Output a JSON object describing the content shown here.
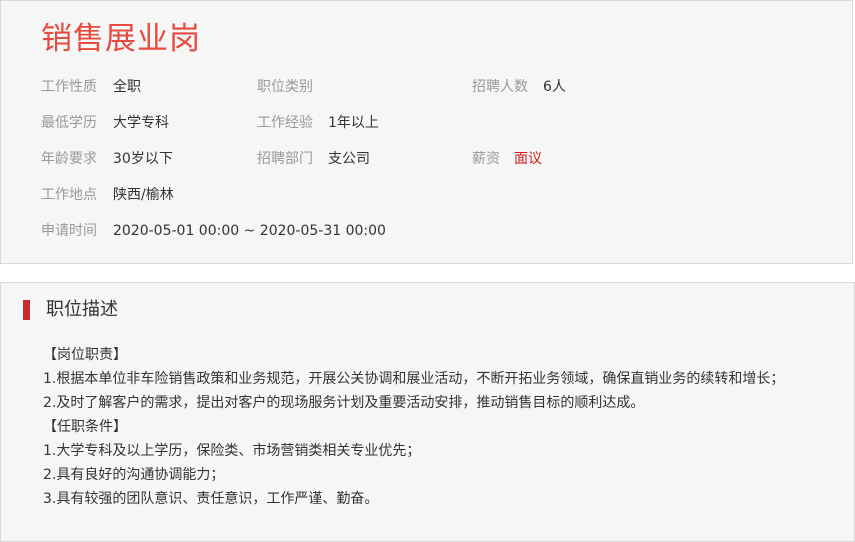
{
  "job": {
    "title": "销售展业岗"
  },
  "fields": {
    "nature_label": "工作性质",
    "nature_value": "全职",
    "category_label": "职位类别",
    "category_value": "",
    "count_label": "招聘人数",
    "count_value": "6人",
    "education_label": "最低学历",
    "education_value": "大学专科",
    "experience_label": "工作经验",
    "experience_value": "1年以上",
    "age_label": "年龄要求",
    "age_value": "30岁以下",
    "department_label": "招聘部门",
    "department_value": "支公司",
    "salary_label": "薪资",
    "salary_value": "面议",
    "location_label": "工作地点",
    "location_value": "陕西/榆林",
    "apply_time_label": "申请时间",
    "apply_time_value": "2020-05-01 00:00 ~ 2020-05-31 00:00"
  },
  "description": {
    "section_title": "职位描述",
    "lines": [
      "【岗位职责】",
      "1.根据本单位非车险销售政策和业务规范，开展公关协调和展业活动，不断开拓业务领域，确保直销业务的续转和增长；",
      "2.及时了解客户的需求，提出对客户的现场服务计划及重要活动安排，推动销售目标的顺利达成。",
      "【任职条件】",
      "1.大学专科及以上学历，保险类、市场营销类相关专业优先；",
      "2.具有良好的沟通协调能力；",
      "3.具有较强的团队意识、责任意识，工作严谨、勤奋。"
    ]
  },
  "colors": {
    "title_red": "#e74a3f",
    "salary_red": "#cc1f1f",
    "section_bar": "#cc2b2b",
    "label_gray": "#999999",
    "text_dark": "#333333",
    "card_bg": "#f6f6f6"
  }
}
